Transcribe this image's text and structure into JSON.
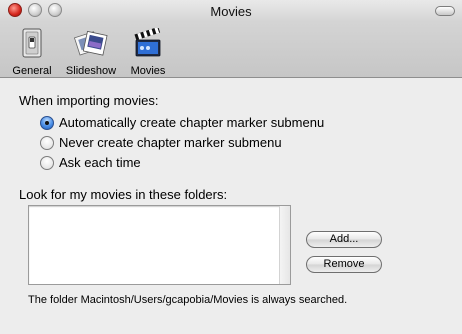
{
  "window": {
    "title": "Movies"
  },
  "toolbar": {
    "items": [
      {
        "label": "General",
        "icon": "light-switch-icon"
      },
      {
        "label": "Slideshow",
        "icon": "slideshow-icon"
      },
      {
        "label": "Movies",
        "icon": "clapperboard-icon"
      }
    ]
  },
  "importing": {
    "label": "When importing movies:",
    "options": [
      {
        "label": "Automatically create chapter marker submenu",
        "selected": true
      },
      {
        "label": "Never create chapter marker submenu",
        "selected": false
      },
      {
        "label": "Ask each time",
        "selected": false
      }
    ]
  },
  "folders": {
    "label": "Look for my movies in these folders:",
    "items": [],
    "add_label": "Add...",
    "remove_label": "Remove",
    "note": "The folder Macintosh/Users/gcapobia/Movies is always searched."
  }
}
